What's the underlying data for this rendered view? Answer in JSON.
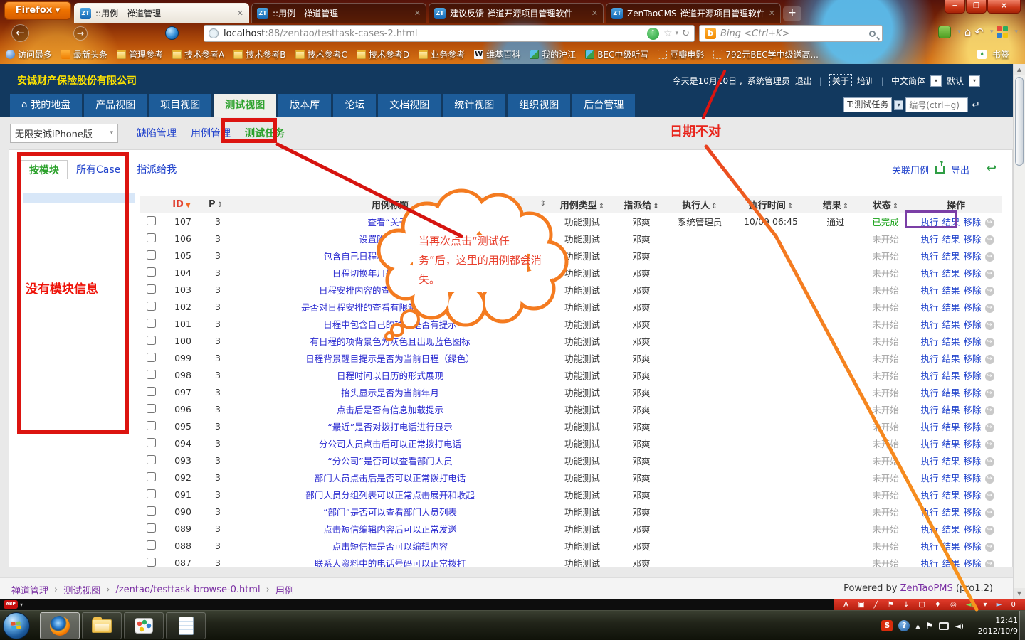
{
  "browser": {
    "menu_label": "Firefox",
    "tabs": [
      {
        "title": "::用例 - 禅道管理",
        "active": true
      },
      {
        "title": "::用例 - 禅道管理",
        "active": false
      },
      {
        "title": "建议反馈-禅道开源项目管理软件",
        "active": false
      },
      {
        "title": "ZenTaoCMS-禅道开源项目管理软件",
        "active": false
      }
    ],
    "url_domain": "localhost",
    "url_path": ":88/zentao/testtask-cases-2.html",
    "search_placeholder": "Bing <Ctrl+K>",
    "bookmarks": [
      {
        "label": "访问最多",
        "icon": "search"
      },
      {
        "label": "最新头条",
        "icon": "rss"
      },
      {
        "label": "管理参考",
        "icon": "folder"
      },
      {
        "label": "技术参考A",
        "icon": "folder"
      },
      {
        "label": "技术参考B",
        "icon": "folder"
      },
      {
        "label": "技术参考C",
        "icon": "folder"
      },
      {
        "label": "技术参考D",
        "icon": "folder"
      },
      {
        "label": "业务参考",
        "icon": "folder"
      },
      {
        "label": "维基百科",
        "icon": "wiki"
      },
      {
        "label": "我的沪江",
        "icon": "pic"
      },
      {
        "label": "BEC中级听写",
        "icon": "pic"
      },
      {
        "label": "豆瓣电影",
        "icon": "dotted"
      },
      {
        "label": "792元BEC学中级送高...",
        "icon": "dotted"
      }
    ],
    "bookmarks_button": "书签"
  },
  "zentao": {
    "company": "安诚财产保险股份有限公司",
    "userbar": {
      "today": "今天是10月10日 ,",
      "user": "系统管理员",
      "logout": "退出",
      "about": "关于",
      "training": "培训",
      "lang": "中文简体",
      "skin": "默认"
    },
    "nav": [
      {
        "label": "我的地盘",
        "icon": "home",
        "active": false
      },
      {
        "label": "产品视图",
        "active": false
      },
      {
        "label": "项目视图",
        "active": false
      },
      {
        "label": "测试视图",
        "active": true
      },
      {
        "label": "版本库",
        "active": false
      },
      {
        "label": "论坛",
        "active": false
      },
      {
        "label": "文档视图",
        "active": false
      },
      {
        "label": "统计视图",
        "active": false
      },
      {
        "label": "组织视图",
        "active": false
      },
      {
        "label": "后台管理",
        "active": false
      }
    ],
    "nav_search": {
      "type_value": "T:测试任务",
      "placeholder": "编号(ctrl+g)"
    },
    "subnav": {
      "product": "无限安诚iPhone版",
      "links": [
        {
          "label": "缺陷管理",
          "active": false
        },
        {
          "label": "用例管理",
          "active": false
        },
        {
          "label": "测试任务",
          "active": true
        }
      ]
    },
    "sidebar": {
      "tabs": [
        {
          "label": "按模块",
          "active": true
        },
        {
          "label": "所有Case",
          "active": false
        },
        {
          "label": "指派给我",
          "active": false
        }
      ]
    },
    "panel_toolbar": {
      "link_cases": "关联用例",
      "export_label": "导出"
    },
    "table": {
      "headers": [
        {
          "key": "cb",
          "label": ""
        },
        {
          "key": "id",
          "label": "ID",
          "sort": "desc"
        },
        {
          "key": "p",
          "label": "P",
          "sort": "both"
        },
        {
          "key": "title",
          "label": "用例标题",
          "sort": "right"
        },
        {
          "key": "type",
          "label": "用例类型",
          "sort": "both"
        },
        {
          "key": "assigned",
          "label": "指派给",
          "sort": "both"
        },
        {
          "key": "runner",
          "label": "执行人",
          "sort": "both"
        },
        {
          "key": "runtime",
          "label": "执行时间",
          "sort": "both"
        },
        {
          "key": "result",
          "label": "结果",
          "sort": "both"
        },
        {
          "key": "status",
          "label": "状态",
          "sort": "both"
        },
        {
          "key": "action",
          "label": "操作"
        }
      ],
      "action_labels": [
        "执行",
        "结果",
        "移除"
      ],
      "rows": [
        {
          "id": "107",
          "p": "3",
          "title": "查看“关于”",
          "type": "功能测试",
          "assigned": "邓爽",
          "runner": "系统管理员",
          "runtime": "10/09 06:45",
          "result": "通过",
          "status": "已完成"
        },
        {
          "id": "106",
          "p": "3",
          "title": "设置附属手机号",
          "type": "功能测试",
          "assigned": "邓爽",
          "runner": "",
          "runtime": "",
          "result": "",
          "status": "未开始"
        },
        {
          "id": "105",
          "p": "3",
          "title": "包含自己日程项是是否有闹钟提示",
          "type": "功能测试",
          "assigned": "邓爽",
          "runner": "",
          "runtime": "",
          "result": "",
          "status": "未开始"
        },
        {
          "id": "104",
          "p": "3",
          "title": "日程切换年月是否为左右滑动",
          "type": "功能测试",
          "assigned": "邓爽",
          "runner": "",
          "runtime": "",
          "result": "",
          "status": "未开始"
        },
        {
          "id": "103",
          "p": "3",
          "title": "日程安排内容的查看方式为上下滑动",
          "type": "功能测试",
          "assigned": "邓爽",
          "runner": "",
          "runtime": "",
          "result": "",
          "status": "未开始"
        },
        {
          "id": "102",
          "p": "3",
          "title": "是否对日程安排的查看有限制（是否为一周）",
          "type": "功能测试",
          "assigned": "邓爽",
          "runner": "",
          "runtime": "",
          "result": "",
          "status": "未开始"
        },
        {
          "id": "101",
          "p": "3",
          "title": "日程中包含自己的项时是否有提示",
          "type": "功能测试",
          "assigned": "邓爽",
          "runner": "",
          "runtime": "",
          "result": "",
          "status": "未开始"
        },
        {
          "id": "100",
          "p": "3",
          "title": "有日程的项背景色为灰色且出现蓝色图标",
          "type": "功能测试",
          "assigned": "邓爽",
          "runner": "",
          "runtime": "",
          "result": "",
          "status": "未开始"
        },
        {
          "id": "099",
          "p": "3",
          "title": "日程背景醒目提示是否为当前日程（绿色）",
          "type": "功能测试",
          "assigned": "邓爽",
          "runner": "",
          "runtime": "",
          "result": "",
          "status": "未开始"
        },
        {
          "id": "098",
          "p": "3",
          "title": "日程时间以日历的形式展现",
          "type": "功能测试",
          "assigned": "邓爽",
          "runner": "",
          "runtime": "",
          "result": "",
          "status": "未开始"
        },
        {
          "id": "097",
          "p": "3",
          "title": "抬头显示是否为当前年月",
          "type": "功能测试",
          "assigned": "邓爽",
          "runner": "",
          "runtime": "",
          "result": "",
          "status": "未开始"
        },
        {
          "id": "096",
          "p": "3",
          "title": "点击后是否有信息加载提示",
          "type": "功能测试",
          "assigned": "邓爽",
          "runner": "",
          "runtime": "",
          "result": "",
          "status": "未开始"
        },
        {
          "id": "095",
          "p": "3",
          "title": "“最近”是否对拨打电话进行显示",
          "type": "功能测试",
          "assigned": "邓爽",
          "runner": "",
          "runtime": "",
          "result": "",
          "status": "未开始"
        },
        {
          "id": "094",
          "p": "3",
          "title": "分公司人员点击后可以正常拨打电话",
          "type": "功能测试",
          "assigned": "邓爽",
          "runner": "",
          "runtime": "",
          "result": "",
          "status": "未开始"
        },
        {
          "id": "093",
          "p": "3",
          "title": "“分公司”是否可以查看部门人员",
          "type": "功能测试",
          "assigned": "邓爽",
          "runner": "",
          "runtime": "",
          "result": "",
          "status": "未开始"
        },
        {
          "id": "092",
          "p": "3",
          "title": "部门人员点击后是否可以正常拨打电话",
          "type": "功能测试",
          "assigned": "邓爽",
          "runner": "",
          "runtime": "",
          "result": "",
          "status": "未开始"
        },
        {
          "id": "091",
          "p": "3",
          "title": "部门人员分组列表可以正常点击展开和收起",
          "type": "功能测试",
          "assigned": "邓爽",
          "runner": "",
          "runtime": "",
          "result": "",
          "status": "未开始"
        },
        {
          "id": "090",
          "p": "3",
          "title": "“部门”是否可以查看部门人员列表",
          "type": "功能测试",
          "assigned": "邓爽",
          "runner": "",
          "runtime": "",
          "result": "",
          "status": "未开始"
        },
        {
          "id": "089",
          "p": "3",
          "title": "点击短信编辑内容后可以正常发送",
          "type": "功能测试",
          "assigned": "邓爽",
          "runner": "",
          "runtime": "",
          "result": "",
          "status": "未开始"
        },
        {
          "id": "088",
          "p": "3",
          "title": "点击短信框是否可以编辑内容",
          "type": "功能测试",
          "assigned": "邓爽",
          "runner": "",
          "runtime": "",
          "result": "",
          "status": "未开始"
        },
        {
          "id": "087",
          "p": "3",
          "title": "联系人资料中的电话号码可以正常拨打",
          "type": "功能测试",
          "assigned": "邓爽",
          "runner": "",
          "runtime": "",
          "result": "",
          "status": "未开始"
        }
      ]
    },
    "footer": {
      "crumbs": [
        "禅道管理",
        "测试视图",
        "/zentao/testtask-browse-0.html",
        "用例"
      ],
      "powered_prefix": "Powered by",
      "powered_link": "ZenTaoPMS",
      "powered_suffix": "(pro1.2)"
    }
  },
  "annotations": {
    "no_module": "没有模块信息",
    "wrong_date": "日期不对",
    "bubble": "当再次点击“测试任务”后，这里的用例都会消失。",
    "accent_red": "#dc1410",
    "accent_orange": "#f47b20",
    "accent_purple": "#7b3fa6"
  },
  "annotation_toolbar": {
    "icons": [
      "text",
      "frame",
      "brush",
      "flag",
      "download",
      "layers",
      "shirt",
      "target",
      "volume",
      "caret",
      "play"
    ],
    "count": "0"
  },
  "addon": {
    "abp": "ABP"
  },
  "taskbar": {
    "time": "12:41",
    "date": "2012/10/9"
  }
}
